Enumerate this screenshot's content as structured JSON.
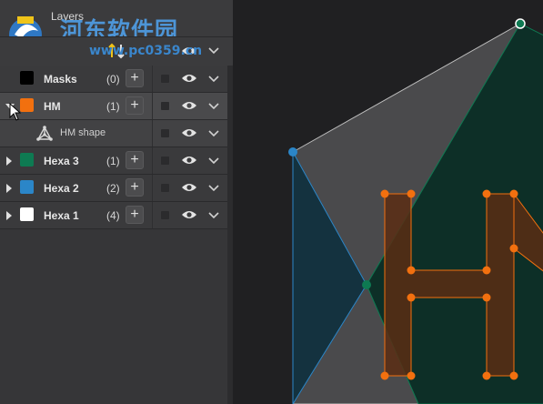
{
  "panel": {
    "title": "Layers",
    "watermark": {
      "site_name": "河东软件园",
      "url": "www.pc0359.cn"
    }
  },
  "layers": [
    {
      "name": "Masks",
      "count": "(0)",
      "color": "#000000",
      "expanded": false,
      "selected": false
    },
    {
      "name": "HM",
      "count": "(1)",
      "color": "#f2700f",
      "expanded": true,
      "selected": true,
      "children": [
        {
          "name": "HM shape",
          "icon": "shape-icon"
        }
      ]
    },
    {
      "name": "Hexa 3",
      "count": "(1)",
      "color": "#0e7a52",
      "expanded": false,
      "selected": false
    },
    {
      "name": "Hexa 2",
      "count": "(2)",
      "color": "#2b86c8",
      "expanded": false,
      "selected": false
    },
    {
      "name": "Hexa 1",
      "count": "(4)",
      "color": "#ffffff",
      "expanded": false,
      "selected": false
    }
  ],
  "controls": {
    "add_label": "+",
    "visibility_icon": "eye-icon",
    "menu_icon": "chevron-down-icon",
    "sort_icon": "sort-arrows-icon"
  },
  "colors": {
    "accent_orange": "#f2700f",
    "handle_blue": "#2b86c8",
    "handle_green": "#0e7a52",
    "panel_bg": "#363638",
    "canvas_bg": "#202022"
  }
}
